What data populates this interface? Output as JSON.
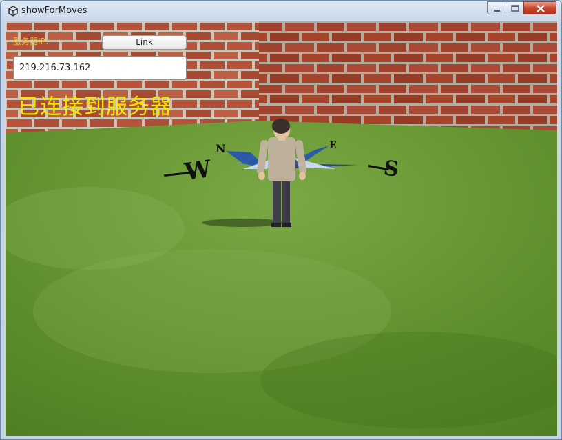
{
  "window": {
    "title": "showForMoves"
  },
  "ui": {
    "server_ip_label": "服务器IP：",
    "link_label": "Link",
    "ip_value": "219.216.73.162",
    "status_text": "已连接到服务器"
  },
  "compass": {
    "west": "W",
    "north": "N",
    "east": "E",
    "south": "S"
  },
  "colors": {
    "label": "#f0c030",
    "status": "#f2e900",
    "grass": "#6a9a35",
    "brick": "#b04a30",
    "compass": "#1f3f8a"
  }
}
